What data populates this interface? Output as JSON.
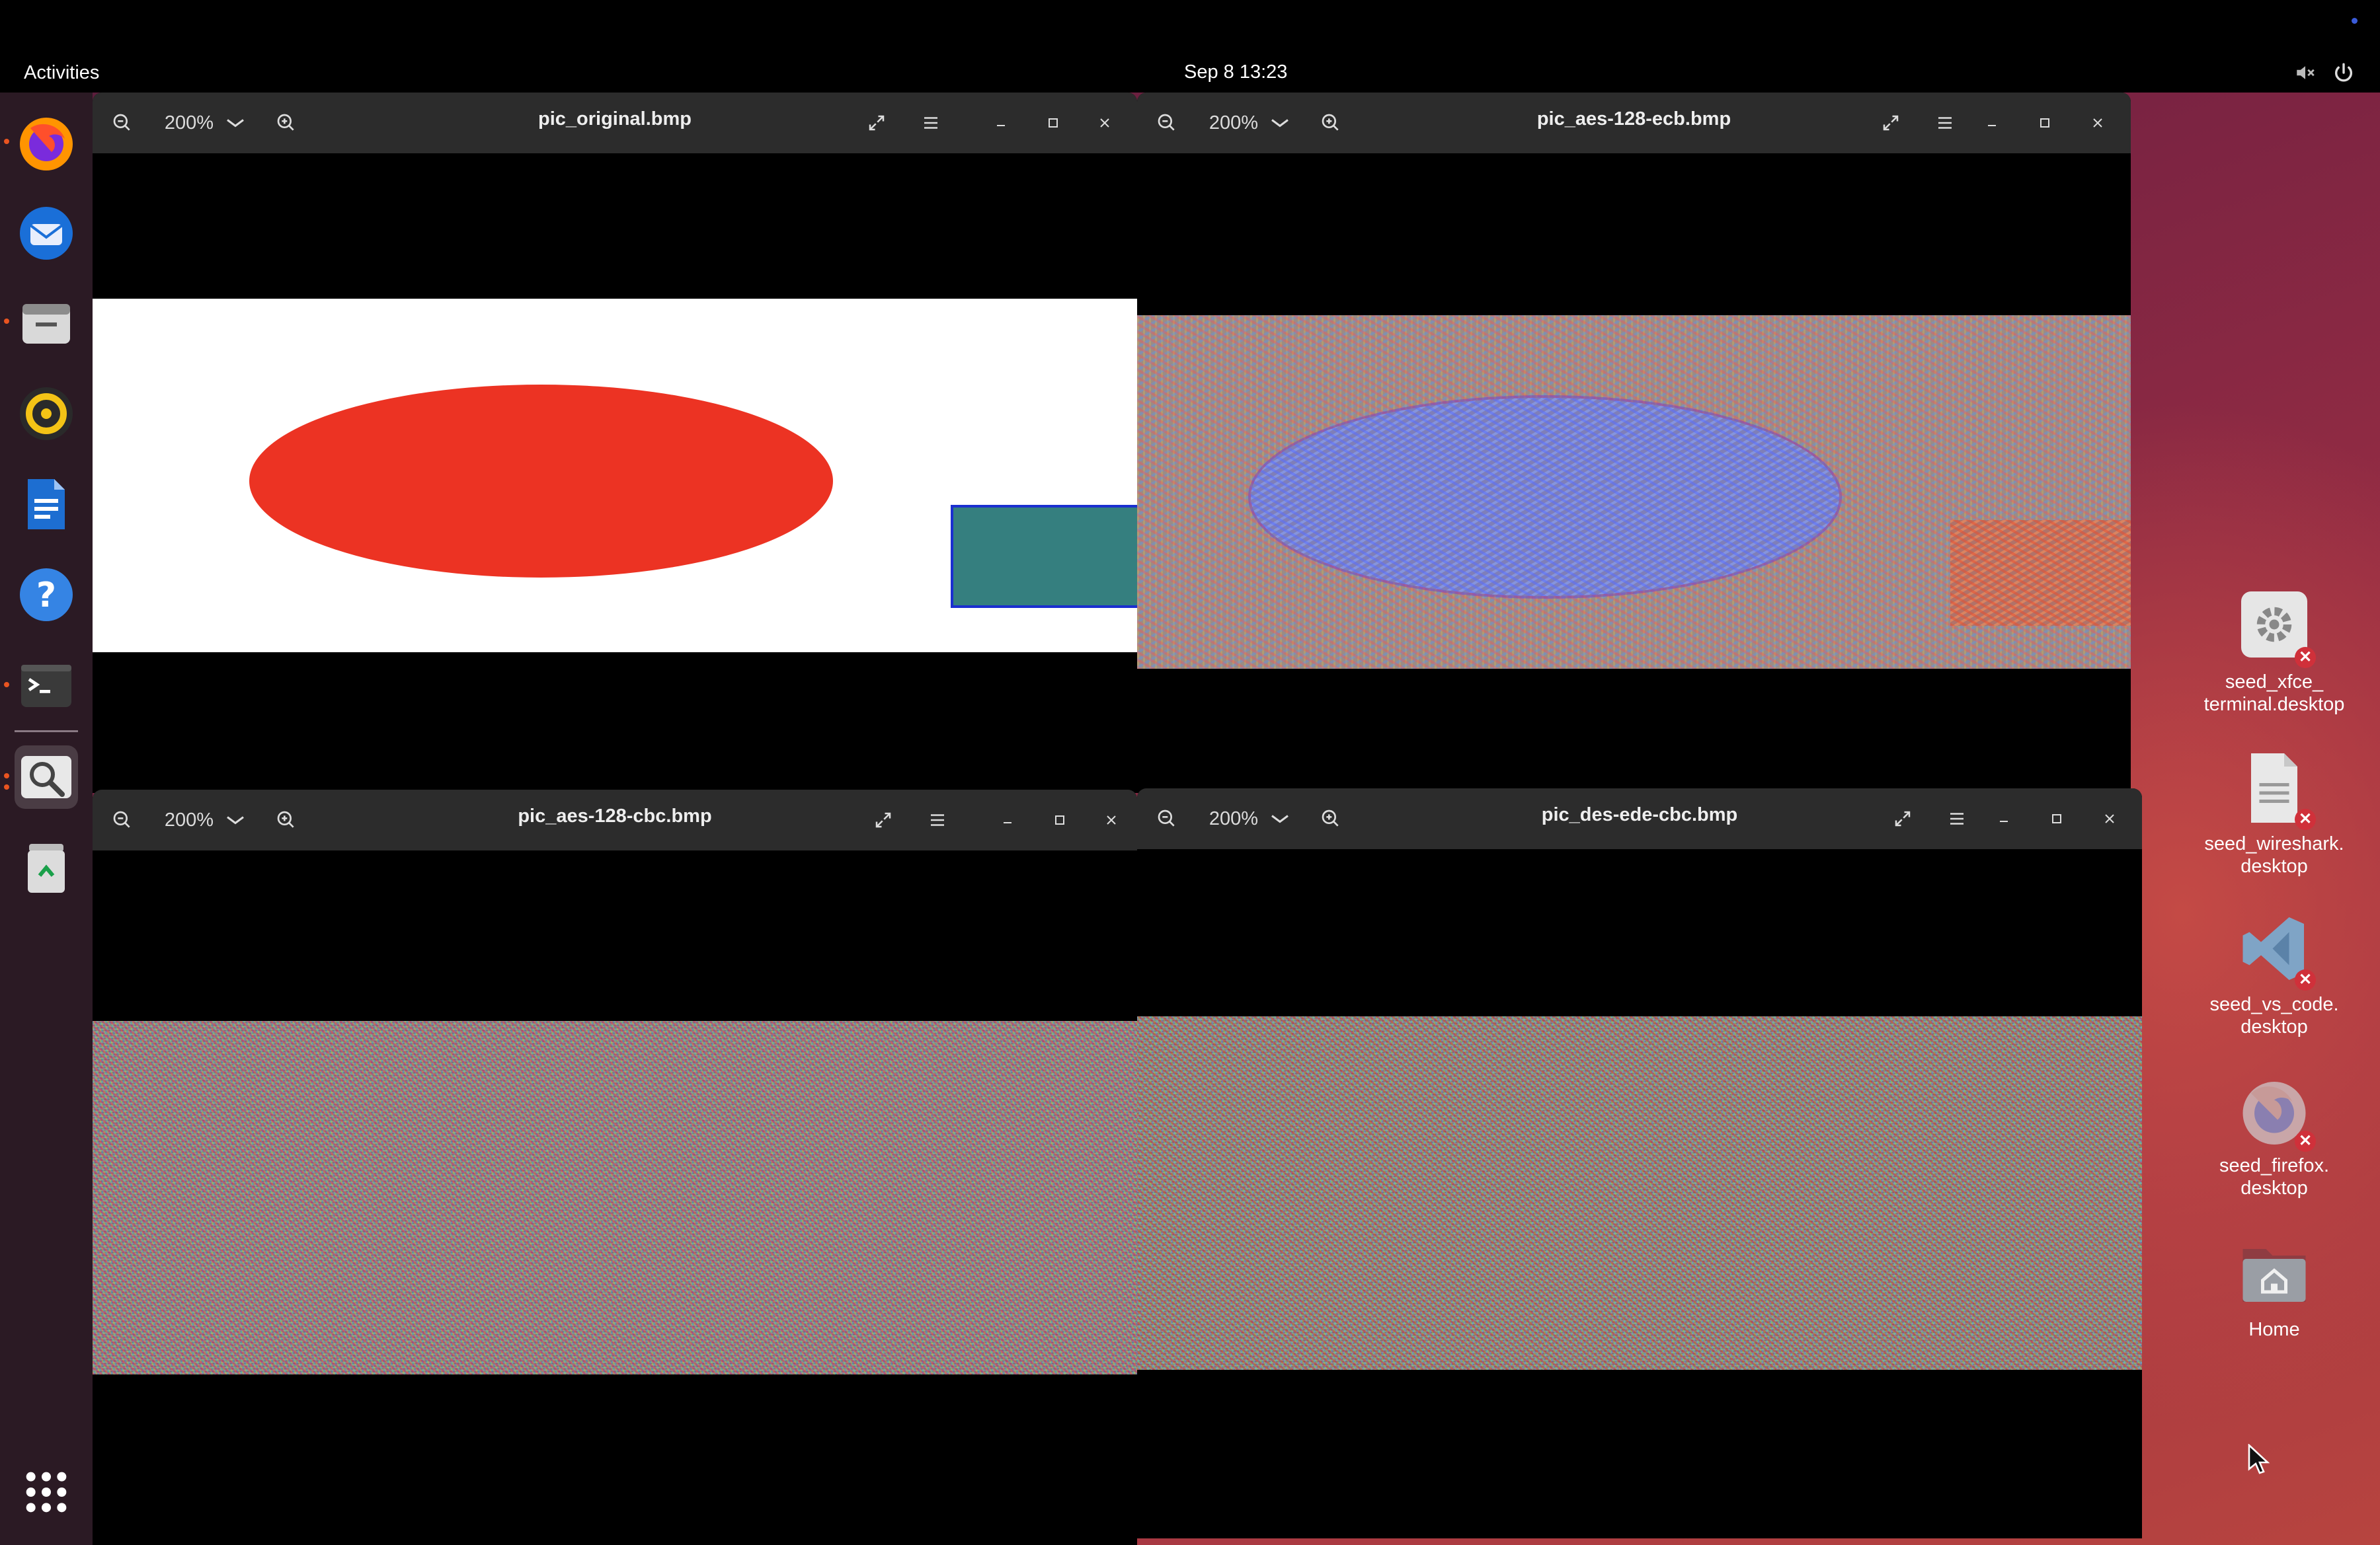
{
  "panel": {
    "activities": "Activities",
    "clock": "Sep 8  13:23"
  },
  "dock": {
    "items": [
      "firefox-icon",
      "thunderbird-icon",
      "files-icon",
      "rhythmbox-icon",
      "writer-icon",
      "help-icon",
      "terminal-icon",
      "image-viewer-icon",
      "trash-icon",
      "show-apps-icon"
    ]
  },
  "windows": [
    {
      "title": "pic_original.bmp",
      "zoom": "200%"
    },
    {
      "title": "pic_aes-128-ecb.bmp",
      "zoom": "200%"
    },
    {
      "title": "pic_aes-128-cbc.bmp",
      "zoom": "200%"
    },
    {
      "title": "pic_des-ede-cbc.bmp",
      "zoom": "200%"
    }
  ],
  "desktop_icons": [
    {
      "label1": "seed_xfce_",
      "label2": "terminal.desktop",
      "icon": "gear-icon"
    },
    {
      "label1": "seed_wireshark.",
      "label2": "desktop",
      "icon": "document-icon"
    },
    {
      "label1": "seed_vs_code.",
      "label2": "desktop",
      "icon": "vscode-icon"
    },
    {
      "label1": "seed_firefox.",
      "label2": "desktop",
      "icon": "firefox-icon"
    },
    {
      "label1": "Home",
      "label2": "",
      "icon": "home-folder-icon"
    }
  ],
  "colors": {
    "ellipse_red": "#ec3323",
    "rect_teal": "#357f7f",
    "rect_border": "#1b2fd0",
    "headerbar": "#2c2c2c"
  }
}
